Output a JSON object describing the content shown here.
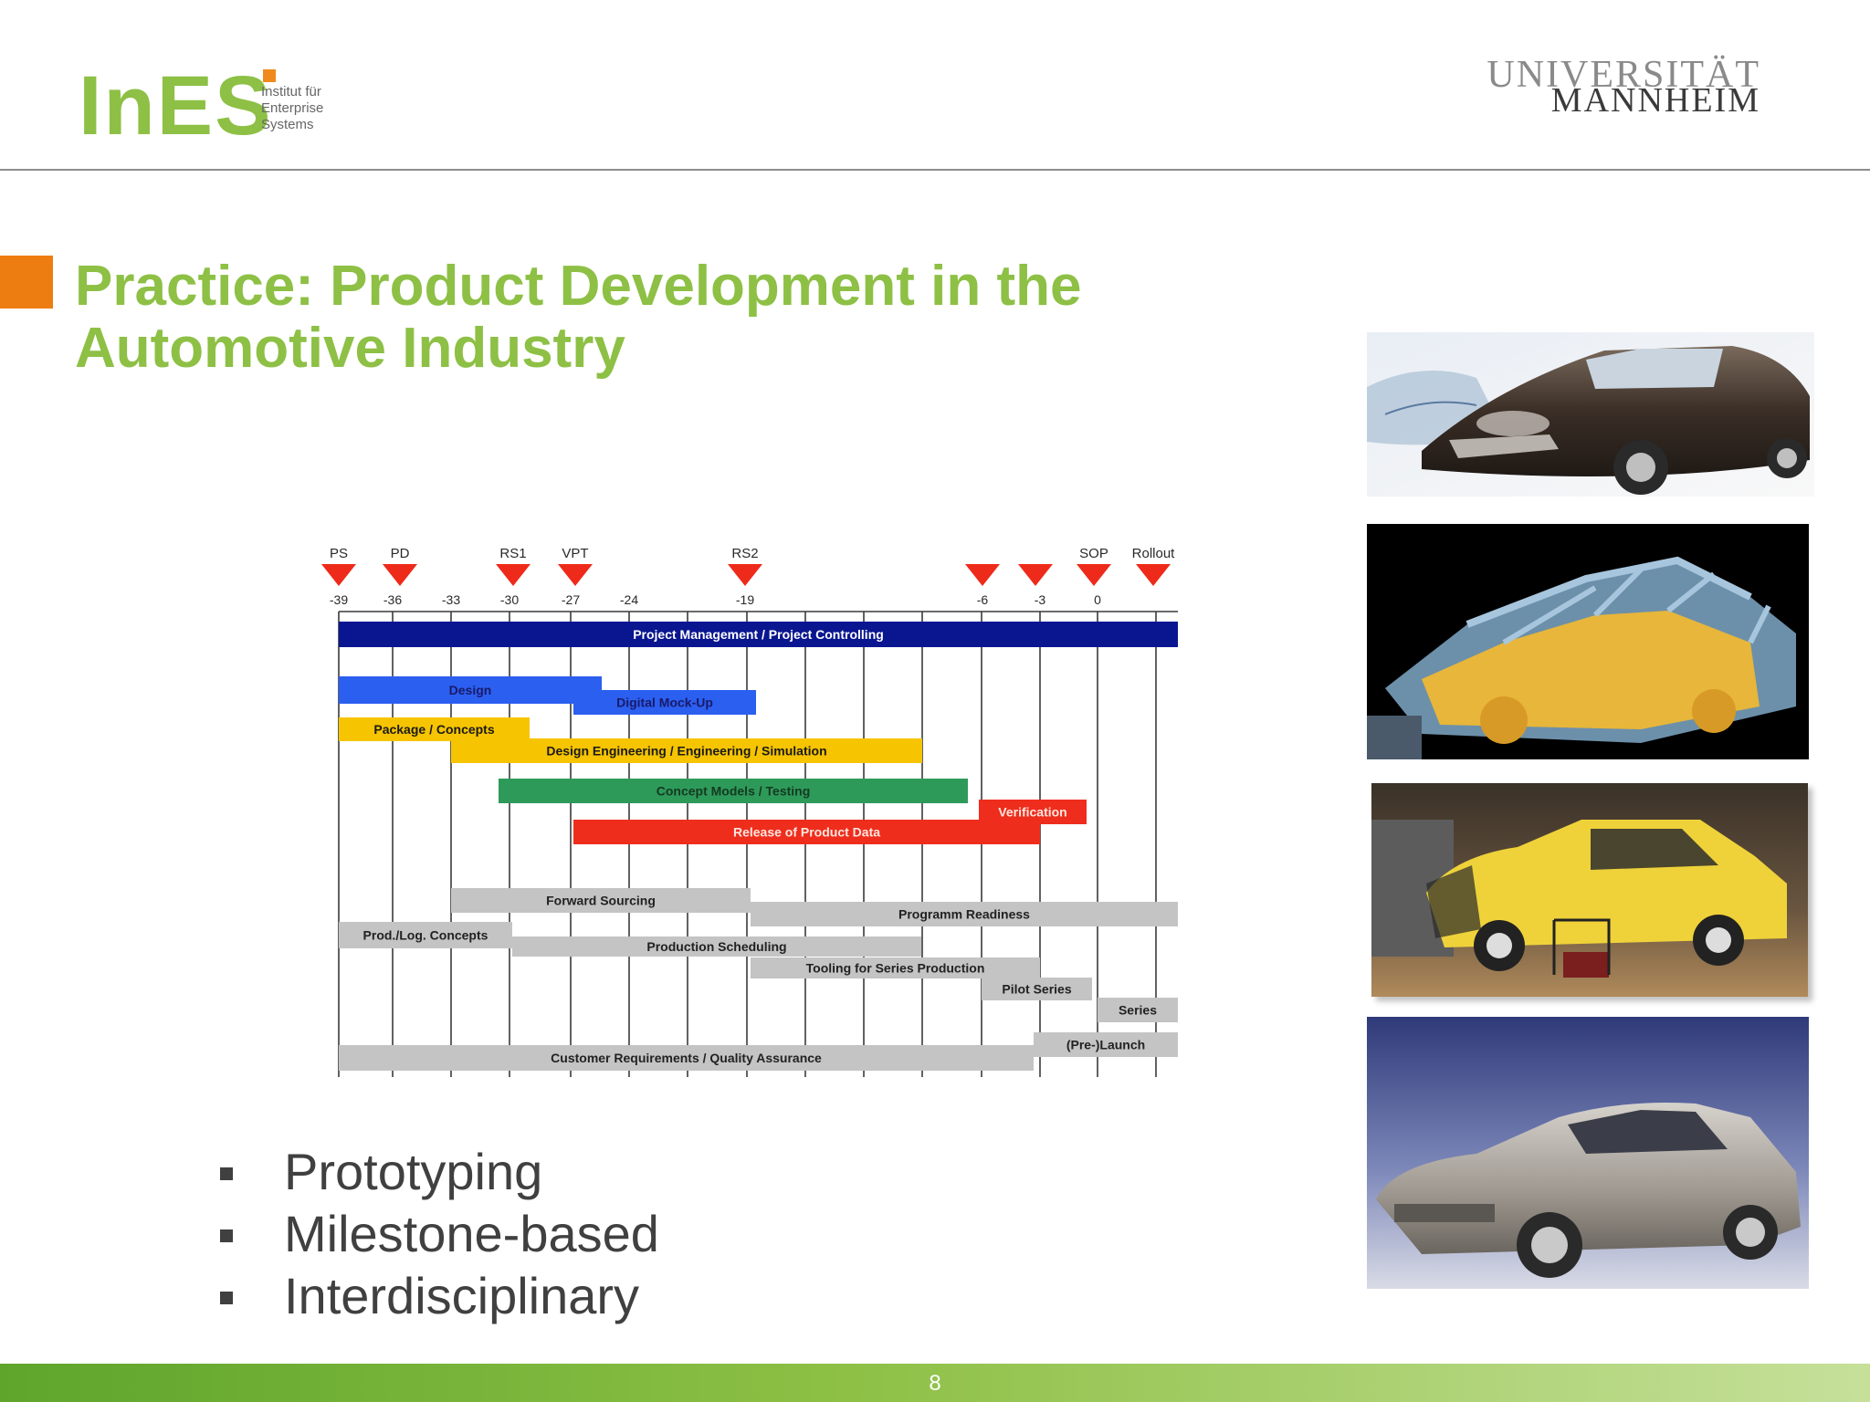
{
  "logo": {
    "main": "InES",
    "sub_line1": "Institut für",
    "sub_line2": "Enterprise",
    "sub_line3": "Systems"
  },
  "university": {
    "line1": "UNIVERSITÄT",
    "line2": "MANNHEIM"
  },
  "title": {
    "line1": "Practice: Product Development in the",
    "line2": "Automotive Industry"
  },
  "timeline": {
    "milestones": [
      {
        "label": "PS",
        "month": -39
      },
      {
        "label": "PD",
        "month": -36
      },
      {
        "label": "RS1",
        "month": -30
      },
      {
        "label": "VPT",
        "month": -27
      },
      {
        "label": "RS2",
        "month": -19
      },
      {
        "label": "",
        "month": -6
      },
      {
        "label": "",
        "month": -3
      },
      {
        "label": "SOP",
        "month": 0
      },
      {
        "label": "Rollout",
        "month": 3
      }
    ],
    "ticks": [
      "-39",
      "-36",
      "-33",
      "-30",
      "-27",
      "-24",
      "-19",
      "-6",
      "-3",
      "0"
    ],
    "tasks": [
      {
        "label": "Project Management / Project Controlling",
        "color": "#0a1690",
        "text_color": "#ffffff"
      },
      {
        "label": "Design",
        "color": "#2b5ff0",
        "text_color": "#1a1a6a"
      },
      {
        "label": "Digital Mock-Up",
        "color": "#2b5ff0",
        "text_color": "#1a1a6a"
      },
      {
        "label": "Package / Concepts",
        "color": "#f6c400",
        "text_color": "#1a1a1a"
      },
      {
        "label": "Design Engineering / Engineering / Simulation",
        "color": "#f6c400",
        "text_color": "#1a1a1a"
      },
      {
        "label": "Concept Models / Testing",
        "color": "#2e9a5a",
        "text_color": "#143a20"
      },
      {
        "label": "Verification",
        "color": "#ee2d1c",
        "text_color": "#ffe6e0"
      },
      {
        "label": "Release of Product Data",
        "color": "#ee2d1c",
        "text_color": "#ffe6e0"
      },
      {
        "label": "Forward Sourcing",
        "color": "#c4c4c4",
        "text_color": "#222222"
      },
      {
        "label": "Programm Readiness",
        "color": "#c4c4c4",
        "text_color": "#222222"
      },
      {
        "label": "Prod./Log. Concepts",
        "color": "#c4c4c4",
        "text_color": "#222222"
      },
      {
        "label": "Production Scheduling",
        "color": "#c4c4c4",
        "text_color": "#222222"
      },
      {
        "label": "Tooling for Series Production",
        "color": "#c4c4c4",
        "text_color": "#222222"
      },
      {
        "label": "Pilot Series",
        "color": "#c4c4c4",
        "text_color": "#222222"
      },
      {
        "label": "Series",
        "color": "#c4c4c4",
        "text_color": "#222222"
      },
      {
        "label": "(Pre-)Launch",
        "color": "#c4c4c4",
        "text_color": "#222222"
      },
      {
        "label": "Customer Requirements / Quality Assurance",
        "color": "#c4c4c4",
        "text_color": "#222222"
      }
    ]
  },
  "bullets": [
    "Prototyping",
    "Milestone-based",
    "Interdisciplinary"
  ],
  "photos": [
    "car-design-sketch",
    "car-body-structure",
    "crash-test",
    "silver-hatchback"
  ],
  "footer": {
    "page": "8"
  },
  "colors": {
    "accent_green": "#8dc045",
    "accent_orange": "#ee7d11"
  }
}
